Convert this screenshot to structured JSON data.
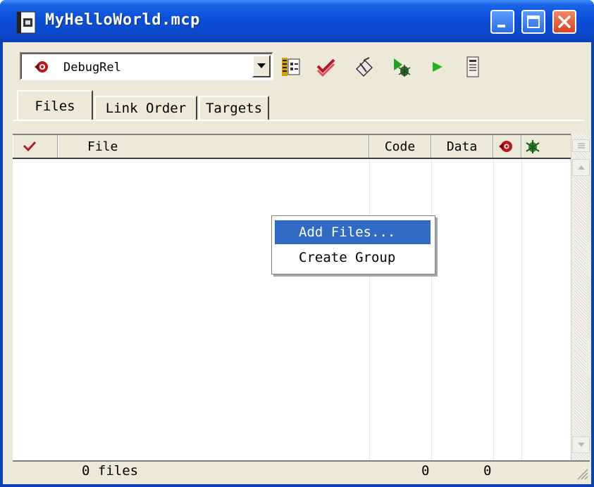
{
  "window": {
    "title": "MyHelloWorld.mcp",
    "colors": {
      "titlebar": "#0a4fd9",
      "frame": "#0a3fb5",
      "face": "#ece9d8",
      "close": "#d9421e",
      "highlight": "#316ac5"
    },
    "controls": [
      {
        "name": "minimize-icon"
      },
      {
        "name": "maximize-icon"
      },
      {
        "name": "close-icon"
      }
    ]
  },
  "toolbar": {
    "target_select": {
      "value": "DebugRel",
      "icon": "target-icon"
    },
    "tools": [
      {
        "name": "settings-icon"
      },
      {
        "name": "synchronize-icon"
      },
      {
        "name": "make-icon"
      },
      {
        "name": "debug-icon"
      },
      {
        "name": "run-icon"
      },
      {
        "name": "project-inspector-icon"
      }
    ]
  },
  "tabs": [
    {
      "label": "Files",
      "active": true
    },
    {
      "label": "Link Order",
      "active": false
    },
    {
      "label": "Targets",
      "active": false
    }
  ],
  "columns": {
    "check_icon": "touch-check-icon",
    "file": "File",
    "code": "Code",
    "data": "Data",
    "target_icon": "target-icon",
    "debug_icon": "debug-bug-icon"
  },
  "status": {
    "files": "0 files",
    "code_total": "0",
    "data_total": "0"
  },
  "context_menu": {
    "items": [
      {
        "label": "Add Files...",
        "highlighted": true
      },
      {
        "label": "Create Group",
        "highlighted": false
      }
    ]
  }
}
